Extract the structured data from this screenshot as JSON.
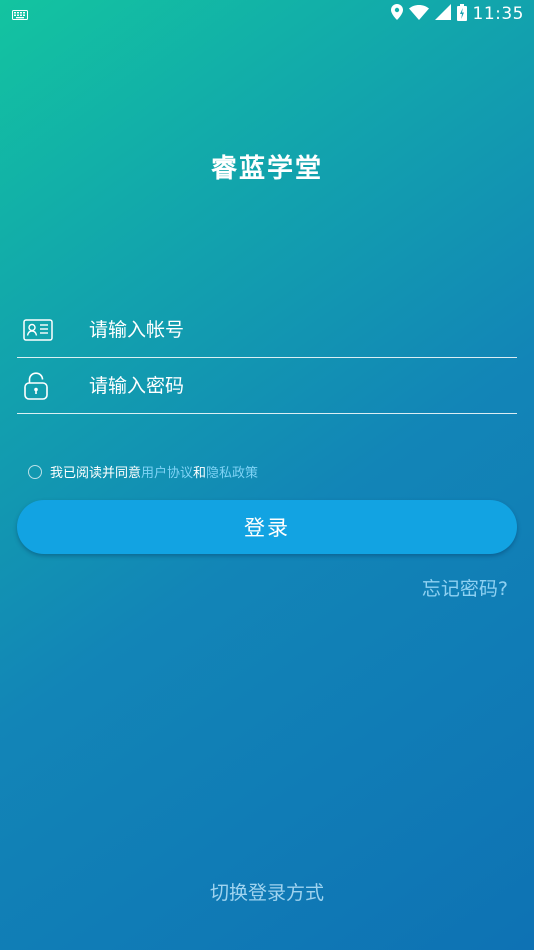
{
  "status_bar": {
    "time": "11:35",
    "icons": [
      "keyboard-icon",
      "location-icon",
      "wifi-icon",
      "signal-icon",
      "battery-icon"
    ]
  },
  "app": {
    "title": "睿蓝学堂"
  },
  "form": {
    "account_placeholder": "请输入帐号",
    "account_value": "",
    "password_placeholder": "请输入密码",
    "password_value": ""
  },
  "agreement": {
    "prefix": "我已阅读并同意",
    "user_agreement": "用户协议",
    "and": "和",
    "privacy_policy": "隐私政策",
    "checked": false
  },
  "actions": {
    "login_label": "登录",
    "forgot_label": "忘记密码?",
    "switch_label": "切换登录方式"
  },
  "colors": {
    "gradient_start": "#13c4a0",
    "gradient_end": "#0e72b4",
    "button": "#12a3e2",
    "link": "#7fd3f5"
  }
}
